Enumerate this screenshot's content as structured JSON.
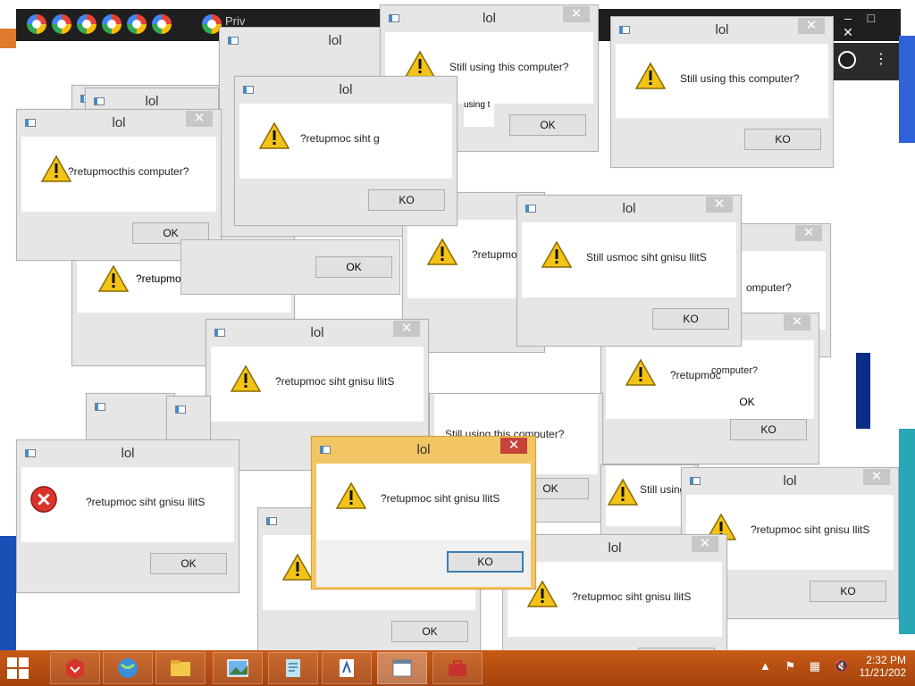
{
  "background": {
    "browser_tab_text": "Priv",
    "titlebar_buttons": [
      "–",
      "□",
      "✕"
    ]
  },
  "dialog_title": "lol",
  "dialogs": [
    {
      "id": 1,
      "msg": "",
      "btn": ""
    },
    {
      "id": 2,
      "msg": "",
      "btn": ""
    },
    {
      "id": 3,
      "msg": "Still using this computer?",
      "btn": "OK"
    },
    {
      "id": 4,
      "msg": "Still using this computer?",
      "btn": "KO"
    },
    {
      "id": 5,
      "msg": "?retupmoc",
      "btn": ""
    },
    {
      "id": 6,
      "msg": "?retupmocthis computer?",
      "btn": "OK"
    },
    {
      "id": 7,
      "msg": "?retupmoc siht g",
      "btn": "KO"
    },
    {
      "id": 8,
      "msg": "?retupmoc",
      "btn": ""
    },
    {
      "id": 9,
      "msg": "Still usmoc siht gnisu llitS",
      "btn": "KO"
    },
    {
      "id": 10,
      "msg": "?retupmoc siht gnisu llitS",
      "btn": ""
    },
    {
      "id": 11,
      "msg": "Still using this computer?",
      "btn": "OK"
    },
    {
      "id": 12,
      "msg": "?retupmoc",
      "btn": "KO"
    },
    {
      "id": 13,
      "msg": "?retupmoc siht gnisu llitS",
      "btn": "OK"
    },
    {
      "id": 14,
      "msg": "?retupmoc siht gnisu llitS",
      "btn": "KO"
    },
    {
      "id": 15,
      "msg": "?retupmoc siht gnisu llitS",
      "btn": "KO"
    },
    {
      "id": 16,
      "msg": "",
      "btn": "OK"
    },
    {
      "id": 17,
      "msg": "?retupmoc siht gnisu llitS",
      "btn": "KO"
    },
    {
      "id": 18,
      "msg": "Still using",
      "btn": ""
    }
  ],
  "fragments": {
    "using": "using t",
    "computer1": "omputer?",
    "computer2": "computer?",
    "ok_frag": "OK",
    "ok_frag2": "OK"
  },
  "taskbar": {
    "time": "2:32 PM",
    "date": "11/21/202"
  },
  "colors": {
    "taskbar": "#b84f12",
    "active_dialog_frame": "#f2c565",
    "active_close": "#c7423a"
  }
}
